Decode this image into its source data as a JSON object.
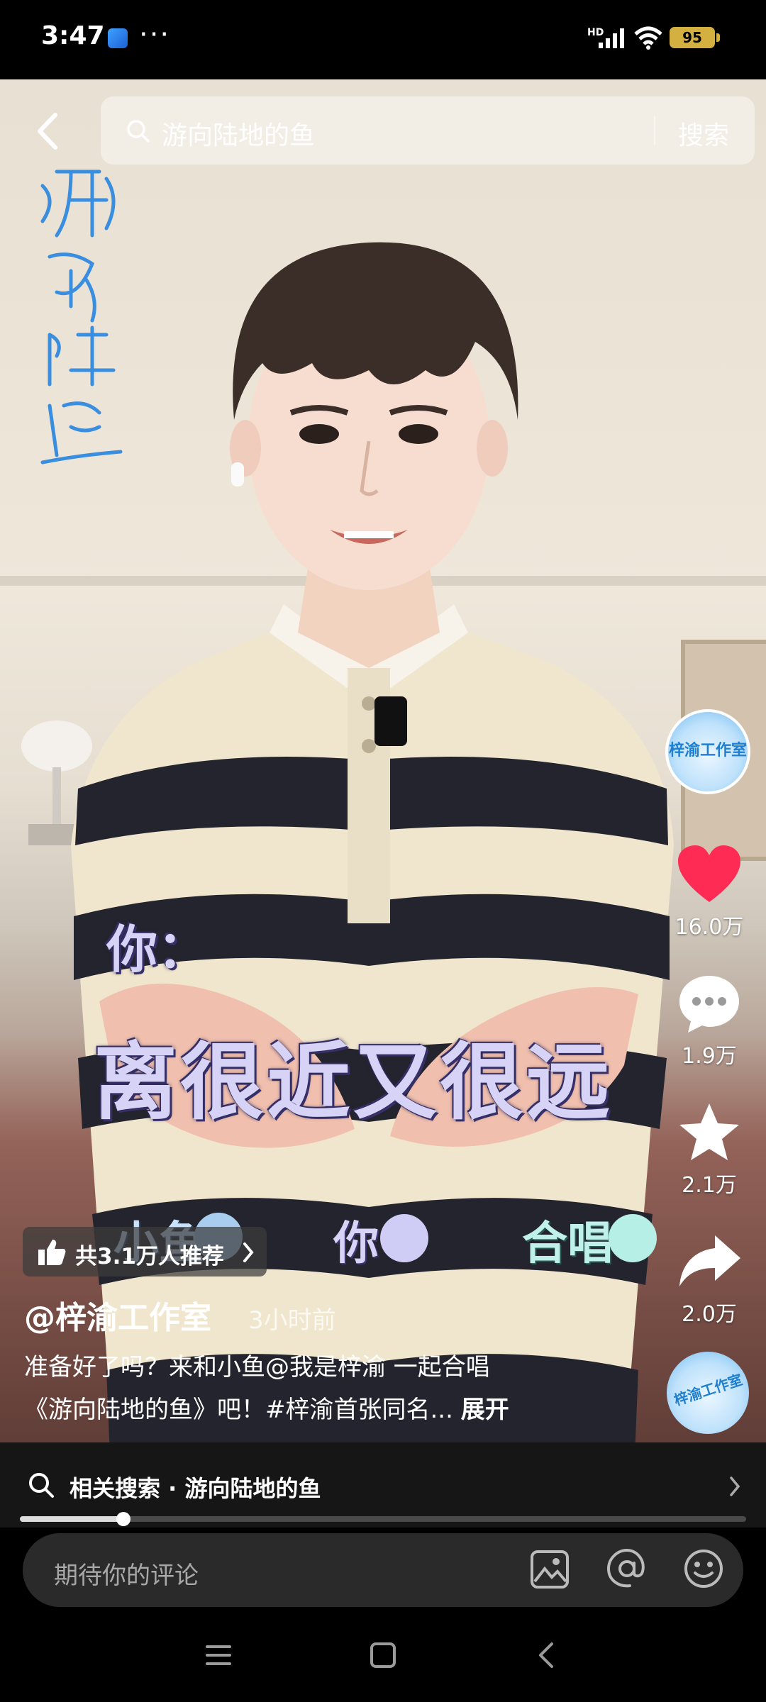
{
  "status_bar": {
    "time": "3:47",
    "dots": "···",
    "hd_label": "HD",
    "battery": "95",
    "colors": {
      "battery": "#d4b040"
    }
  },
  "search": {
    "query": "游向陆地的鱼",
    "button_label": "搜索"
  },
  "overlay": {
    "speaker": "你：",
    "line": "离很近又很远",
    "tags": {
      "xiaoyu": "小鱼",
      "ni": "你",
      "hechang": "合唱"
    }
  },
  "actions": {
    "avatar_text": "梓渝工作室",
    "like_count": "16.0万",
    "comment_count": "1.9万",
    "favorite_count": "2.1万",
    "share_count": "2.0万",
    "like_color": "#fe2c55"
  },
  "recommend": {
    "label": "共3.1万人推荐"
  },
  "post": {
    "author": "@梓渝工作室",
    "time": "3小时前",
    "caption_line1": "准备好了吗？来和小鱼@我是梓渝 一起合唱",
    "caption_line2": "《游向陆地的鱼》吧！#梓渝首张同名...",
    "expand_label": "展开"
  },
  "related_search": {
    "label": "相关搜索 · 游向陆地的鱼"
  },
  "progress": {
    "fraction": 0.143
  },
  "comment_input": {
    "placeholder": "期待你的评论"
  },
  "icons": {
    "back": "back-arrow-icon",
    "search": "search-icon",
    "like": "heart-icon",
    "comment": "comment-bubble-icon",
    "favorite": "star-icon",
    "share": "share-arrow-icon",
    "image": "image-icon",
    "mention": "at-icon",
    "emoji": "emoji-icon"
  }
}
